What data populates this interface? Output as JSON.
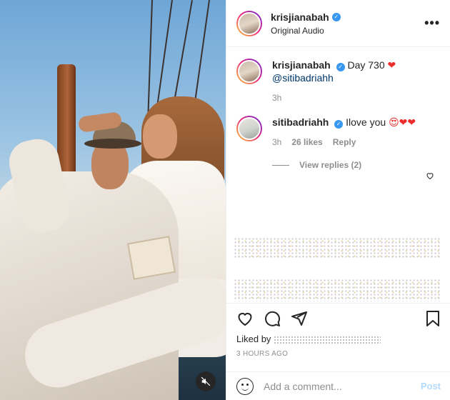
{
  "header": {
    "username": "krisjianabah",
    "subtitle": "Original Audio",
    "more_icon": "•••"
  },
  "caption": {
    "username": "krisjianabah",
    "text": "Day 730",
    "mention": "@sitibadriahh",
    "time": "3h"
  },
  "comment": {
    "username": "sitibadriahh",
    "text": "Ilove you",
    "emojis": "😍❤❤",
    "time": "3h",
    "likes": "26 likes",
    "reply": "Reply",
    "view_replies": "View replies (2)"
  },
  "actions": {
    "liked_by_prefix": "Liked by",
    "time_ago": "3 HOURS AGO"
  },
  "add_comment": {
    "placeholder": "Add a comment...",
    "post_label": "Post"
  },
  "media": {
    "mute_icon": "speaker-muted-icon"
  },
  "colors": {
    "verified": "#3897f0",
    "heart": "#ed2c2c",
    "post_disabled": "#b3dbff"
  }
}
